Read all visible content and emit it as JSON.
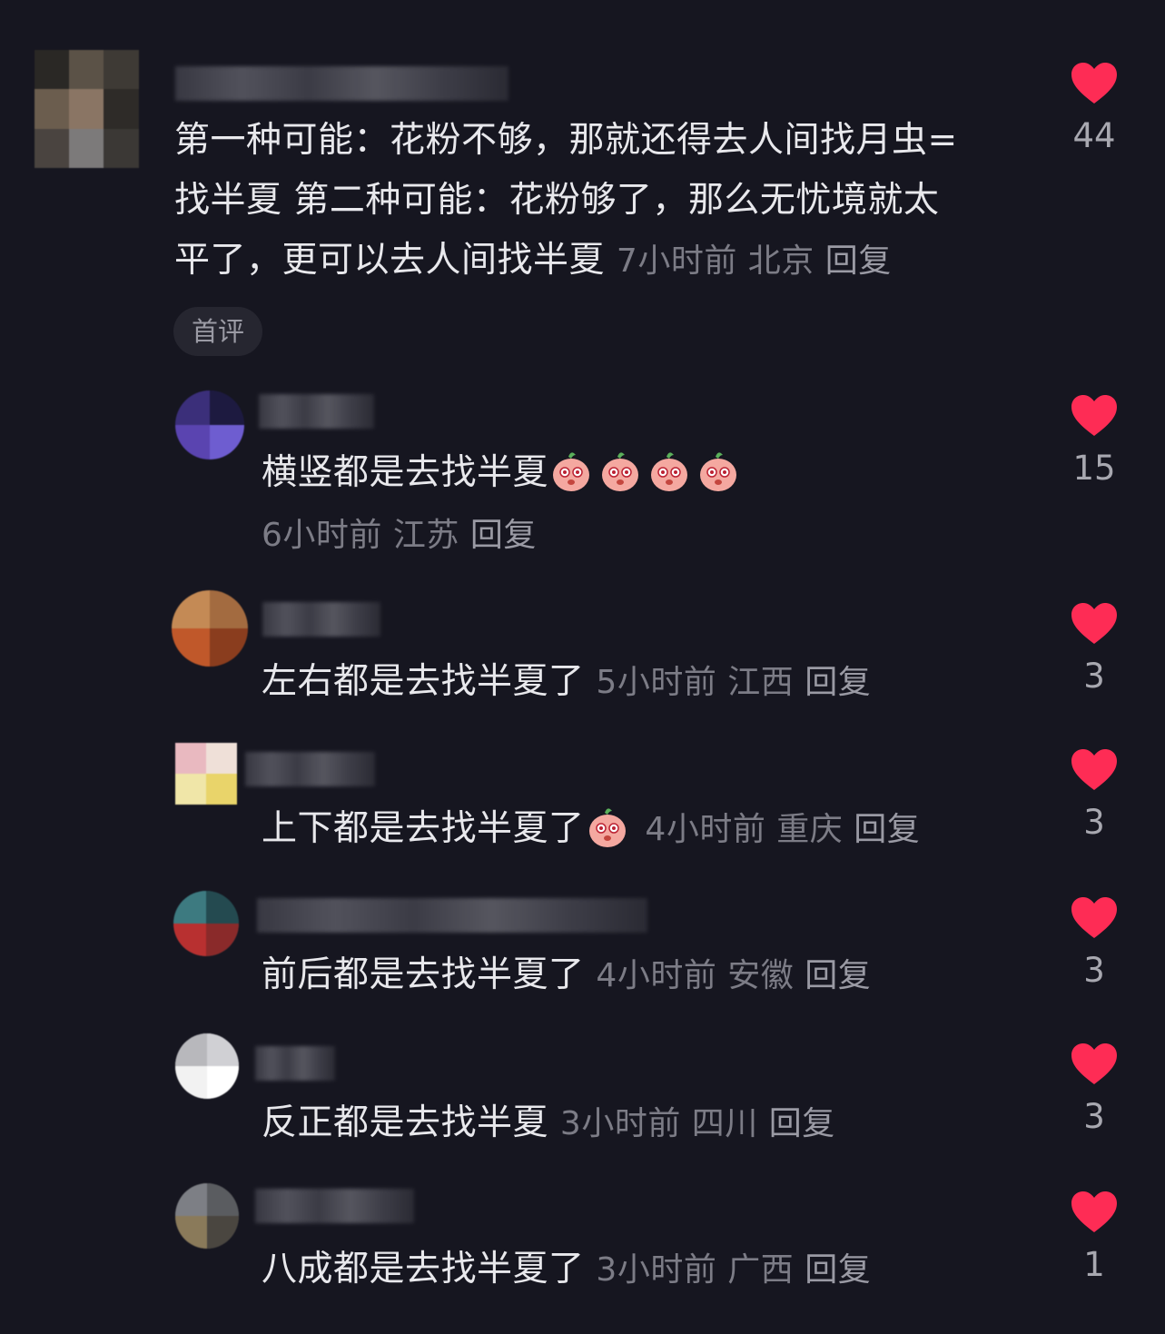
{
  "comments": [
    {
      "text": "第一种可能：花粉不够，那就还得去人间找月虫=找半夏 第二种可能：花粉够了，那么无忧境就太平了，更可以去人间找半夏",
      "line1": "第一种可能：花粉不够，那就还得去人间找月虫=",
      "line2": "找半夏 第二种可能：花粉够了，那么无忧境就太",
      "line3": "平了，更可以去人间找半夏",
      "time": "7小时前",
      "location": "北京",
      "reply": "回复",
      "badge": "首评",
      "likes": "44"
    },
    {
      "text": "横竖都是去找半夏",
      "emoji": "peach-face-emoji",
      "time": "6小时前",
      "location": "江苏",
      "reply": "回复",
      "likes": "15"
    },
    {
      "text": "左右都是去找半夏了",
      "time": "5小时前",
      "location": "江西",
      "reply": "回复",
      "likes": "3"
    },
    {
      "text": "上下都是去找半夏了",
      "emoji": "peach-face-emoji",
      "time": "4小时前",
      "location": "重庆",
      "reply": "回复",
      "likes": "3"
    },
    {
      "text": "前后都是去找半夏了",
      "time": "4小时前",
      "location": "安徽",
      "reply": "回复",
      "likes": "3"
    },
    {
      "text": "反正都是去找半夏",
      "time": "3小时前",
      "location": "四川",
      "reply": "回复",
      "likes": "3"
    },
    {
      "text": "八成都是去找半夏了",
      "time": "3小时前",
      "location": "广西",
      "reply": "回复",
      "likes": "1"
    }
  ],
  "icons": {
    "like": "heart-icon",
    "like_color": "#fe2c55"
  }
}
